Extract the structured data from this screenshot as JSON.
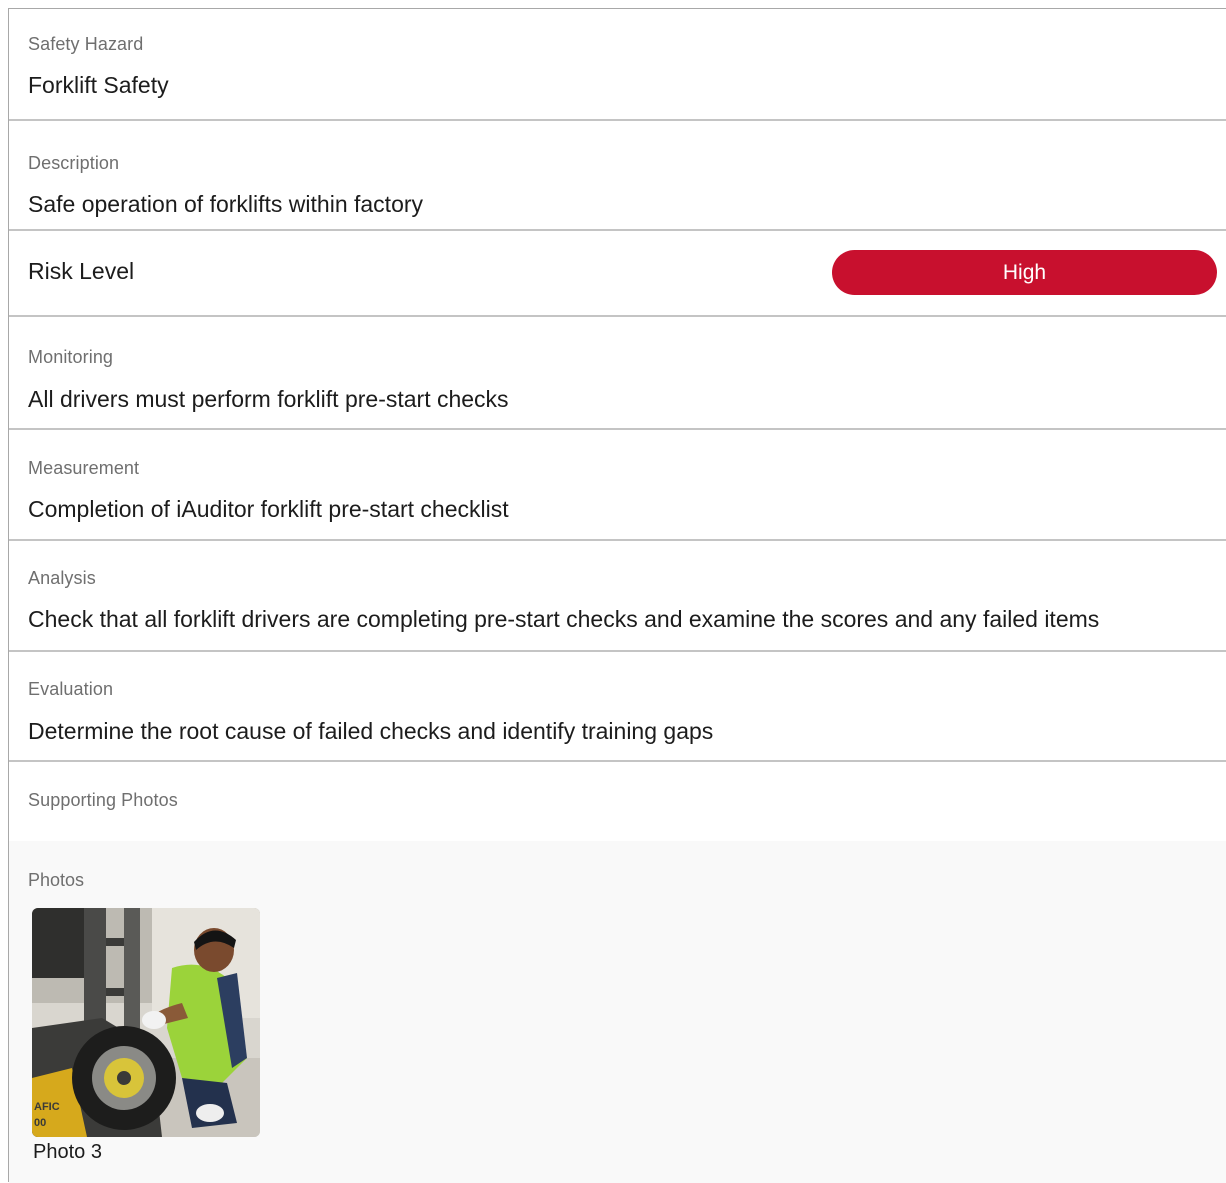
{
  "fields": {
    "hazard": {
      "label": "Safety Hazard",
      "value": "Forklift Safety"
    },
    "description": {
      "label": "Description",
      "value": "Safe operation of forklifts within factory"
    },
    "risk": {
      "label": "Risk Level",
      "value": "High",
      "color": "#c8102e"
    },
    "monitoring": {
      "label": "Monitoring",
      "value": "All drivers must perform forklift pre-start checks"
    },
    "measurement": {
      "label": "Measurement",
      "value": "Completion of iAuditor forklift pre-start checklist"
    },
    "analysis": {
      "label": "Analysis",
      "value": "Check that all forklift drivers are completing pre-start checks and examine the scores and any failed items"
    },
    "evaluation": {
      "label": "Evaluation",
      "value": "Determine the root cause of failed checks and identify training gaps"
    },
    "supporting_photos": {
      "label": "Supporting Photos"
    }
  },
  "photos": {
    "label": "Photos",
    "items": [
      {
        "caption": "Photo 3",
        "decal": "AFIC\n00"
      }
    ]
  }
}
